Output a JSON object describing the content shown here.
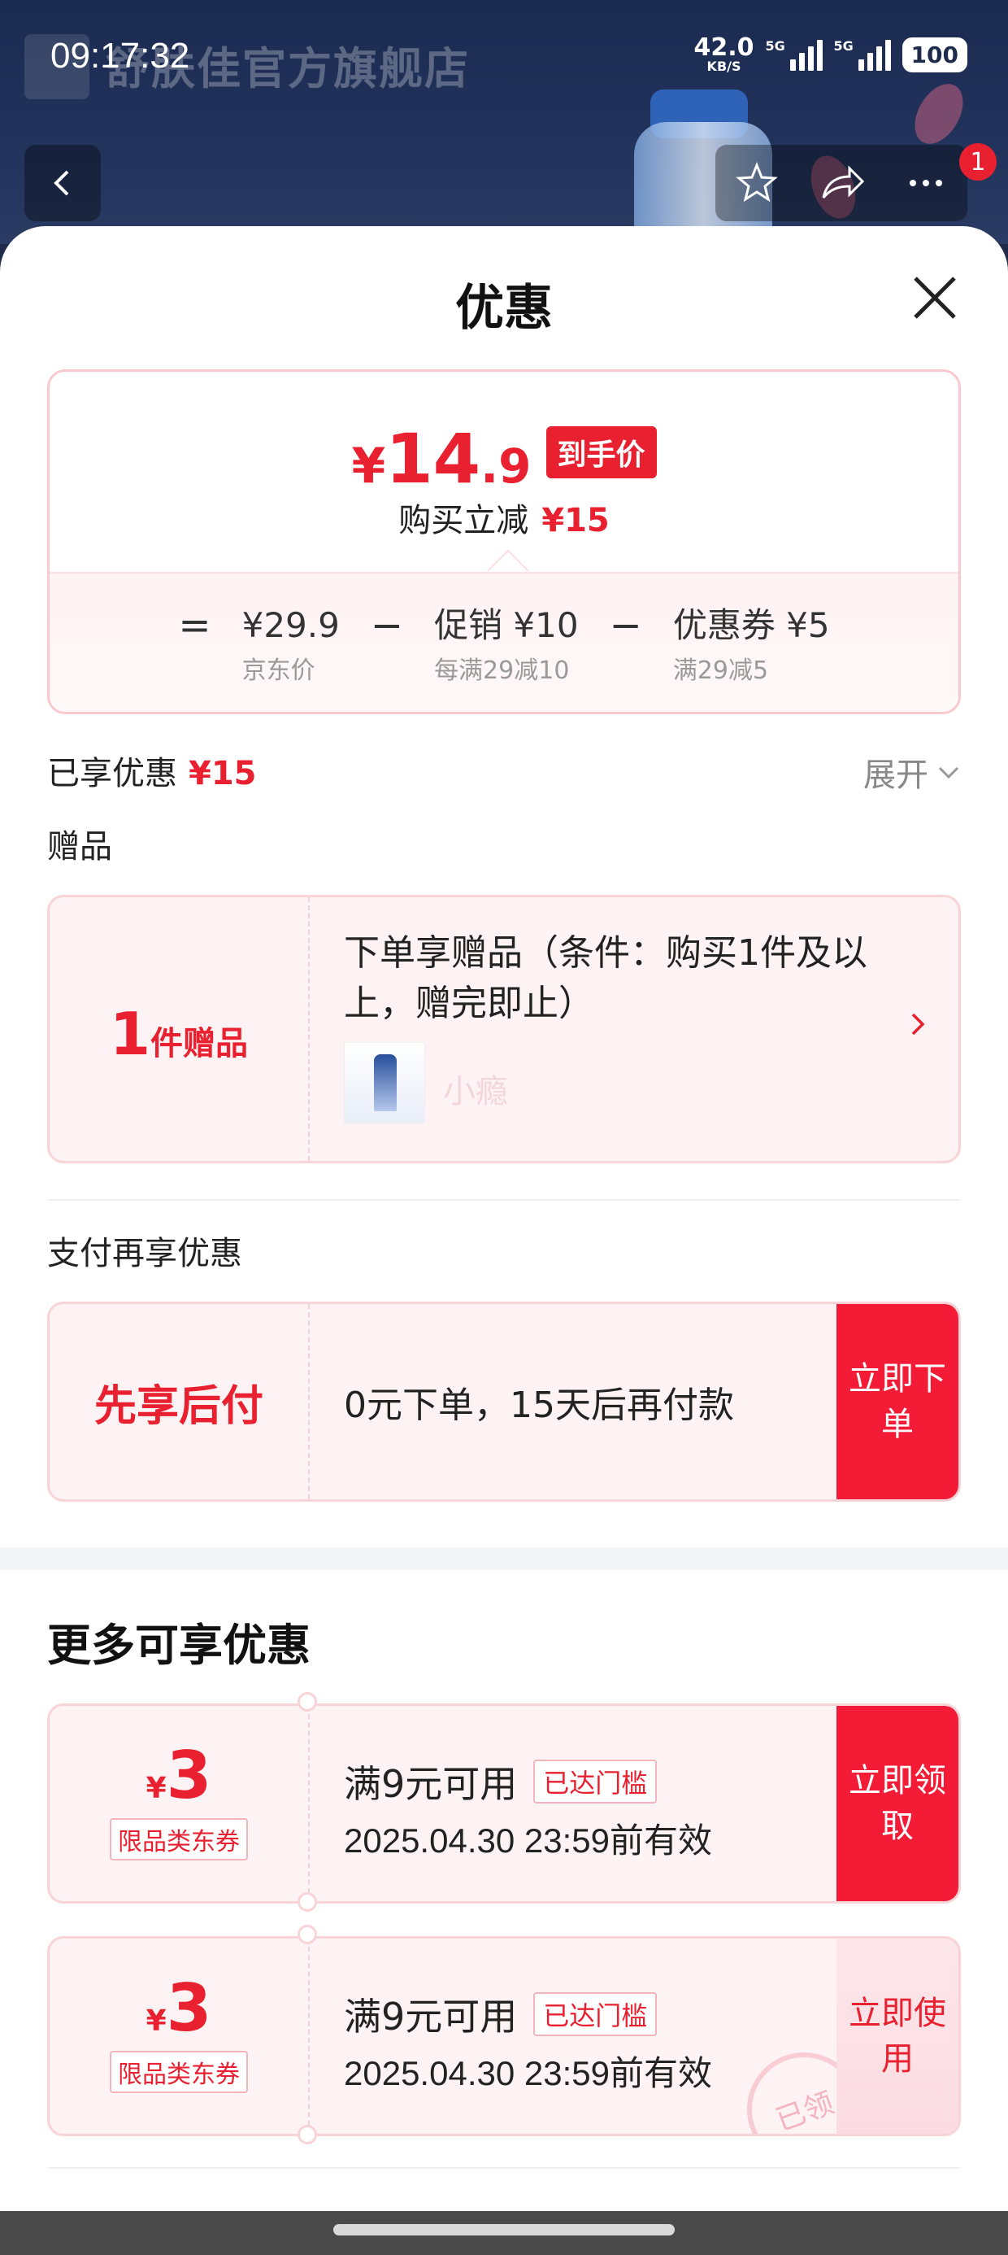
{
  "status_bar": {
    "time": "09:17:32",
    "net_speed": "42.0",
    "net_unit": "KB/S",
    "sim1": "5G",
    "sim2": "5G",
    "battery": "100"
  },
  "backdrop": {
    "store_name": "舒肤佳官方旗舰店",
    "notification_count": "1"
  },
  "sheet": {
    "title": "优惠"
  },
  "price_card": {
    "currency": "¥",
    "price_int": "14",
    "price_dec": ".9",
    "price_tag": "到手价",
    "reduce_label": "购买立减",
    "reduce_amount": "¥15",
    "formula": {
      "equals": "=",
      "jd_price": "¥29.9",
      "jd_price_label": "京东价",
      "minus1": "−",
      "promo": "促销 ¥10",
      "promo_rule": "每满29减10",
      "minus2": "−",
      "coupon": "优惠券 ¥5",
      "coupon_rule": "满29减5"
    }
  },
  "enjoyed": {
    "label": "已享优惠",
    "amount": "¥15",
    "expand_label": "展开"
  },
  "gift": {
    "section_label": "赠品",
    "count": "1",
    "count_unit": "件赠品",
    "description": "下单享赠品（条件：购买1件及以上，赠完即止）",
    "item_name": "小瘾"
  },
  "pay_later": {
    "section_label": "支付再享优惠",
    "title": "先享后付",
    "description": "0元下单，15天后再付款",
    "action": "立即下单"
  },
  "more_offers": {
    "title": "更多可享优惠",
    "coupons": [
      {
        "currency": "¥",
        "amount": "3",
        "type": "限品类东券",
        "condition": "满9元可用",
        "status": "已达门槛",
        "valid": "2025.04.30 23:59前有效",
        "action": "立即领取"
      },
      {
        "currency": "¥",
        "amount": "3",
        "type": "限品类东券",
        "condition": "满9元可用",
        "status": "已达门槛",
        "valid": "2025.04.30 23:59前有效",
        "action": "立即使用",
        "stamp": "已领"
      }
    ]
  },
  "colors": {
    "accent_red": "#e8202f",
    "action_red": "#f31b35",
    "card_bg": "#fdf3f4"
  }
}
